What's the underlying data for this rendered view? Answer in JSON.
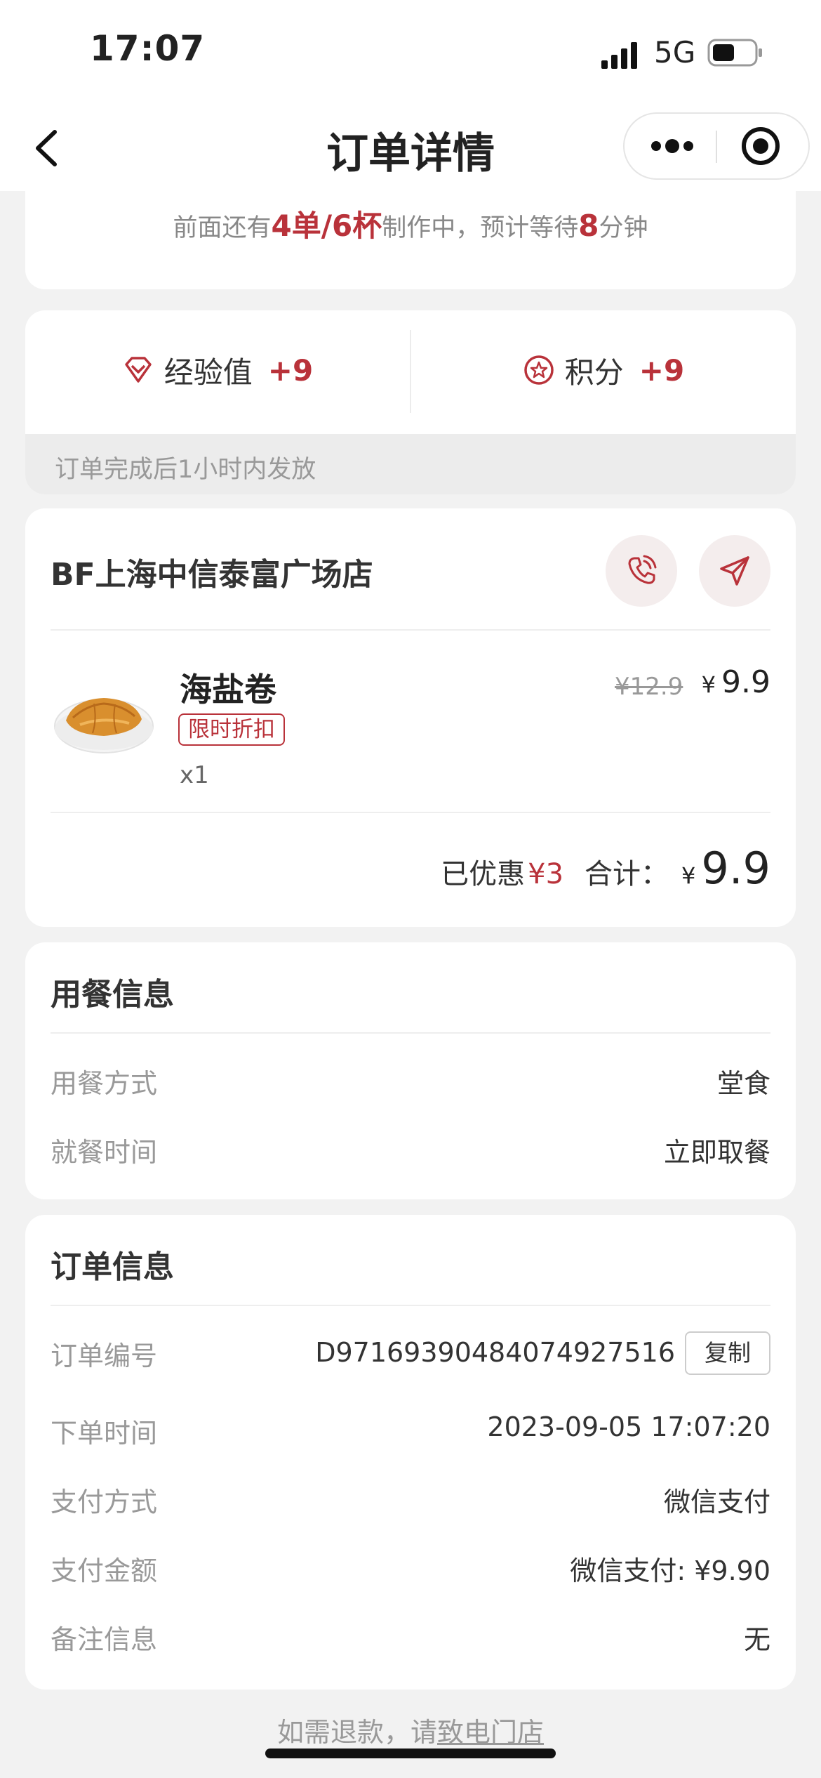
{
  "status_bar": {
    "time": "17:07",
    "network": "5G",
    "battery_level": 0.45
  },
  "nav": {
    "title": "订单详情"
  },
  "queue": {
    "prefix": "前面还有",
    "orders": "4单/6杯",
    "middle": "制作中，预计等待",
    "minutes": "8",
    "suffix": "分钟"
  },
  "rewards": {
    "exp_label": "经验值",
    "exp_value": "+9",
    "points_label": "积分",
    "points_value": "+9",
    "note": "订单完成后1小时内发放"
  },
  "store": {
    "name": "BF上海中信泰富广场店",
    "product": {
      "name": "海盐卷",
      "tag": "限时折扣",
      "quantity": "x1",
      "original_price": "¥12.9",
      "currency": "¥",
      "price": "9.9"
    },
    "saved_label": "已优惠",
    "saved_value": "¥3",
    "total_label": "合计：",
    "total_currency": "¥",
    "total_value": "9.9"
  },
  "dining": {
    "title": "用餐信息",
    "rows": [
      {
        "label": "用餐方式",
        "value": "堂食"
      },
      {
        "label": "就餐时间",
        "value": "立即取餐"
      }
    ]
  },
  "order": {
    "title": "订单信息",
    "copy_label": "复制",
    "rows": [
      {
        "label": "订单编号",
        "value": "D9716939048407492751​6"
      },
      {
        "label": "下单时间",
        "value": "2023-09-05 17:07:20"
      },
      {
        "label": "支付方式",
        "value": "微信支付"
      },
      {
        "label": "支付金额",
        "value": "微信支付: ¥9.90"
      },
      {
        "label": "备注信息",
        "value": "无"
      }
    ]
  },
  "footer": {
    "text": "如需退款，请",
    "link": "致电门店"
  },
  "colors": {
    "accent": "#b9323a",
    "page_bg": "#f2f2f2"
  }
}
